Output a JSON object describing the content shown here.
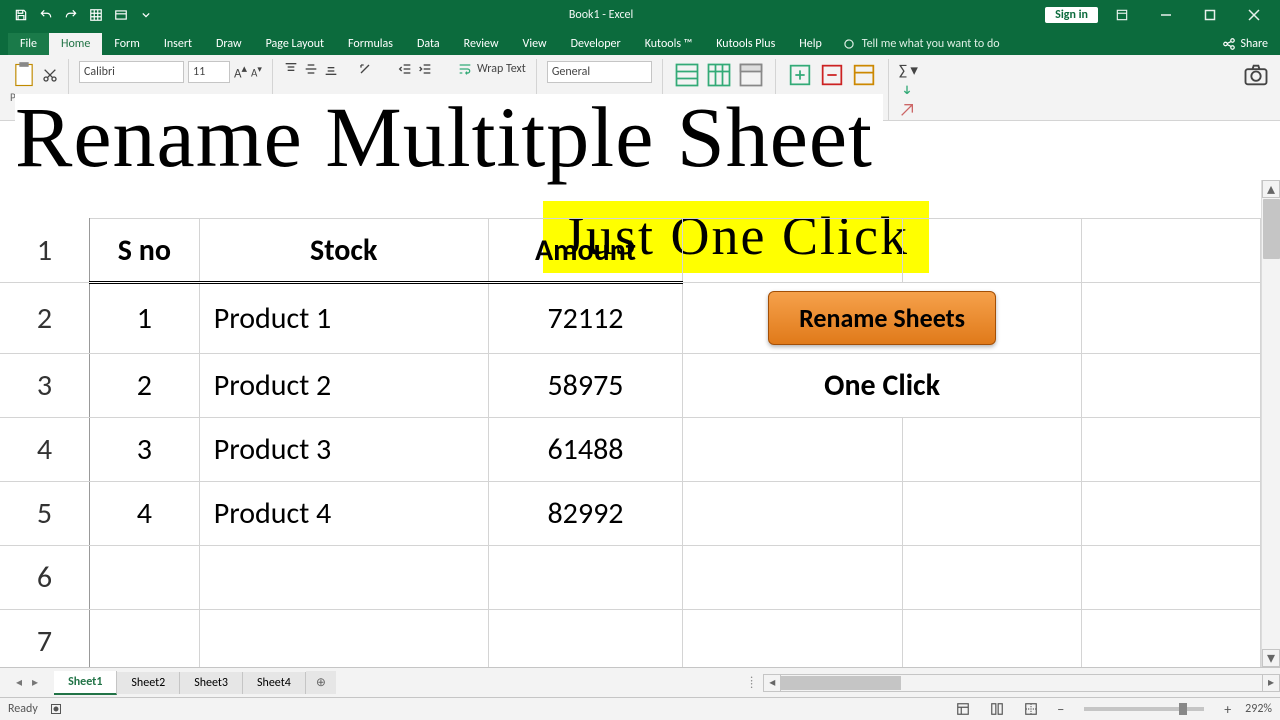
{
  "app": {
    "title": "Book1 - Excel"
  },
  "titlebar": {
    "signin": "Sign in"
  },
  "tabs": {
    "file": "File",
    "items": [
      "Home",
      "Form",
      "Insert",
      "Draw",
      "Page Layout",
      "Formulas",
      "Data",
      "Review",
      "View",
      "Developer",
      "Kutools ™",
      "Kutools Plus",
      "Help"
    ],
    "active": "Home",
    "tell": "Tell me what you want to do",
    "share": "Share"
  },
  "ribbon": {
    "font_name": "Calibri",
    "font_size": "11",
    "wrap": "Wrap Text",
    "number_format": "General"
  },
  "overlay": {
    "main": "Rename Multitple Sheet",
    "sub": "Just One Click"
  },
  "grid": {
    "headers": [
      "S no",
      "Stock",
      "Amount"
    ],
    "rows": [
      {
        "sno": "1",
        "stock": "Product 1",
        "amount": "72112"
      },
      {
        "sno": "2",
        "stock": "Product 2",
        "amount": "58975"
      },
      {
        "sno": "3",
        "stock": "Product 3",
        "amount": "61488"
      },
      {
        "sno": "4",
        "stock": "Product 4",
        "amount": "82992"
      }
    ],
    "row_numbers": [
      "1",
      "2",
      "3",
      "4",
      "5",
      "6",
      "7"
    ],
    "button": "Rename Sheets",
    "one_click": "One Click"
  },
  "sheet_tabs": [
    "Sheet1",
    "Sheet2",
    "Sheet3",
    "Sheet4"
  ],
  "sheet_active": "Sheet1",
  "status": {
    "ready": "Ready",
    "zoom": "292%",
    "plus": "+"
  }
}
